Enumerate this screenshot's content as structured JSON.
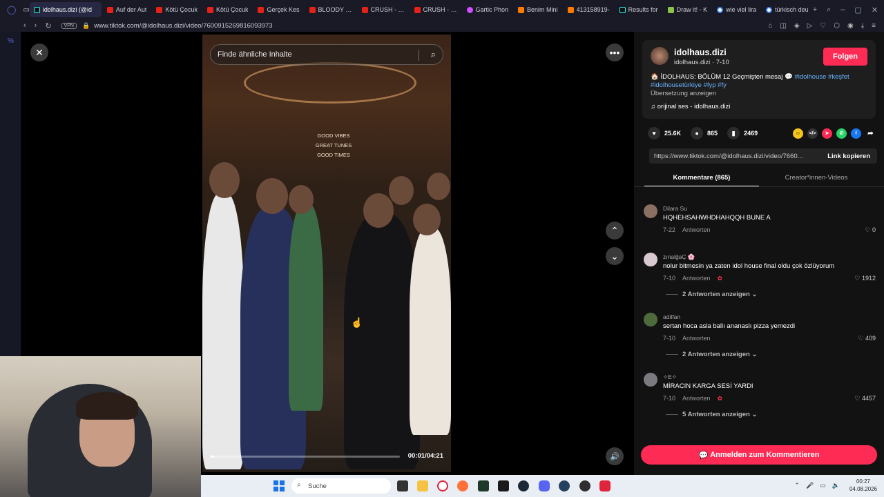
{
  "browser": {
    "tabs": [
      {
        "label": "idolhaus.dizi (@id",
        "icon": "tiktok-icon",
        "active": true
      },
      {
        "label": "Auf der Aut",
        "icon": "youtube-icon"
      },
      {
        "label": "Kötü Çocuk",
        "icon": "youtube-icon"
      },
      {
        "label": "Kötü Çocuk",
        "icon": "youtube-icon"
      },
      {
        "label": "Gerçek Kes",
        "icon": "youtube-icon"
      },
      {
        "label": "BLOODY MA",
        "icon": "youtube-icon"
      },
      {
        "label": "CRUSH - CR",
        "icon": "youtube-icon"
      },
      {
        "label": "CRUSH - CR",
        "icon": "youtube-icon"
      },
      {
        "label": "Gartic Phon",
        "icon": "gartic-icon"
      },
      {
        "label": "Benim Mini",
        "icon": "w-icon"
      },
      {
        "label": "413158919-",
        "icon": "w-icon"
      },
      {
        "label": "Results for",
        "icon": "tiktok-icon"
      },
      {
        "label": "Draw it! - K",
        "icon": "drawit-icon"
      },
      {
        "label": "wie viel lira",
        "icon": "google-icon"
      },
      {
        "label": "türkisch deu",
        "icon": "google-icon"
      }
    ],
    "url": "www.tiktok.com/@idolhaus.dizi/video/7600915269816093973",
    "vpn_label": "VPN"
  },
  "video": {
    "search_placeholder": "Finde ähnliche Inhalte",
    "time": "00:01/04:21",
    "progress": 0.02,
    "neon_sign": [
      "GOOD VIBES",
      "GREAT TUNES",
      "GOOD TIMES"
    ]
  },
  "post": {
    "username": "idolhaus.dizi",
    "subline": "idolhaus.dizi · 7-10",
    "follow": "Folgen",
    "desc_prefix": "🏠 İDOLHAUS: BÖLÜM 12 Geçmişten mesaj 💬",
    "tags_line1": "#idolhouse #keşfet",
    "tags_line2": "#idolhousetürkiye #fyp #fy",
    "translate": "Übersetzung anzeigen",
    "sound": "orijinal ses - idolhaus.dizi",
    "likes": "25.6K",
    "comments_count": "865",
    "saves": "2469",
    "link": "https://www.tiktok.com/@idolhaus.dizi/video/7660...",
    "copy_link": "Link kopieren"
  },
  "tabs2": {
    "comments": "Kommentare (865)",
    "creator": "Creator*innen-Videos"
  },
  "comments": [
    {
      "name": "Dilara Su",
      "text": "HQHEHSAHWHDHAHQQH BUNE A",
      "date": "7-22",
      "reply": "Antworten",
      "likes": "0",
      "replies": ""
    },
    {
      "name": "zınalğaÇ 🌸",
      "text": "nolur bitmesin ya zaten idol house final oldu çok özlüyorum",
      "date": "7-10",
      "reply": "Antworten",
      "likes": "1912",
      "replies": "2 Antworten anzeigen"
    },
    {
      "name": "adilfan",
      "text": "sertan hoca asla ballı ananaslı pizza yemezdi",
      "date": "7-10",
      "reply": "Antworten",
      "likes": "409",
      "replies": "2 Antworten anzeigen"
    },
    {
      "name": "✧E✧",
      "text": "MİRACIN KARGA SESİ YARDI",
      "date": "7-10",
      "reply": "Antworten",
      "likes": "4457",
      "replies": "5 Antworten anzeigen"
    }
  ],
  "comment_button": "Anmelden zum Kommentieren",
  "taskbar": {
    "search": "Suche",
    "time": "00:27",
    "date": "04.08.2026"
  },
  "colors": {
    "accent": "#fe2c55",
    "tag": "#69b3ff"
  }
}
